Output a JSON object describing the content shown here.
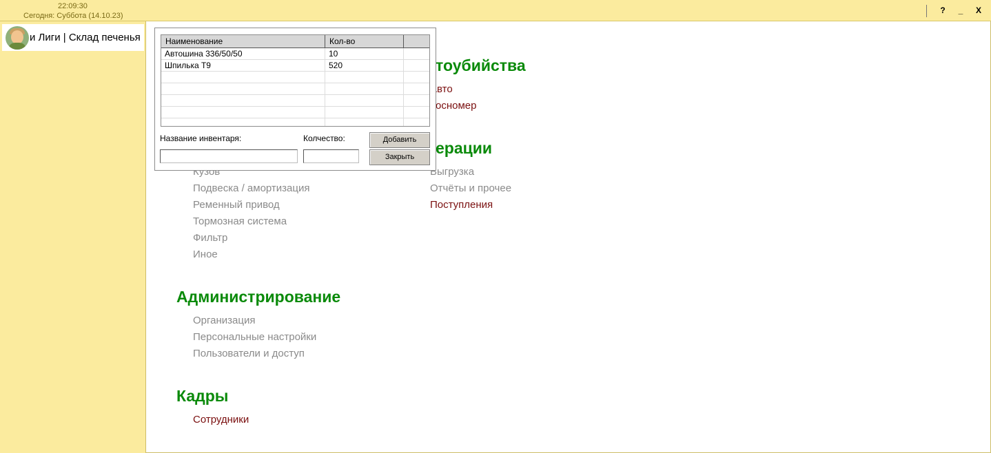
{
  "header": {
    "time": "22:09:30",
    "today": "Сегодня: Суббота (14.10.23)",
    "buttons": {
      "help": "?",
      "minimize": "_",
      "close": "X"
    }
  },
  "sidebar": {
    "tab_label": "и Лиги | Склад печенья"
  },
  "main": {
    "sections": [
      {
        "title": "тоубийства",
        "items": [
          "Авто",
          "осномер"
        ]
      },
      {
        "title": "ерации",
        "items": [
          "Выгрузка",
          "Отчёты и прочее",
          "Поступления"
        ]
      },
      {
        "title": "",
        "items": [
          "Кузов",
          "Подвеска / амортизация",
          "Ременный привод",
          "Тормозная система",
          "Фильтр",
          "Иное"
        ]
      },
      {
        "title": "Администрирование",
        "items": [
          "Организация",
          "Персональные настройки",
          "Пользователи и доступ"
        ]
      },
      {
        "title": "Кадры",
        "items": [
          "Сотрудники"
        ]
      }
    ]
  },
  "dialog": {
    "columns": [
      "Наименование",
      "Кол-во",
      ""
    ],
    "rows": [
      {
        "name": "Автошина 336/50/50",
        "qty": "10"
      },
      {
        "name": "Шпилька Т9",
        "qty": "520"
      }
    ],
    "name_label": "Название инвентаря:",
    "qty_label": "Колчество:",
    "name_value": "",
    "qty_value": "",
    "add_button": "Добавить",
    "close_button": "Закрыть"
  },
  "colors": {
    "frame_bg": "#fbeb9e",
    "section_title": "#0a8a0a",
    "link_inactive": "#8a8a8a",
    "link_active": "#7a0f0f"
  }
}
